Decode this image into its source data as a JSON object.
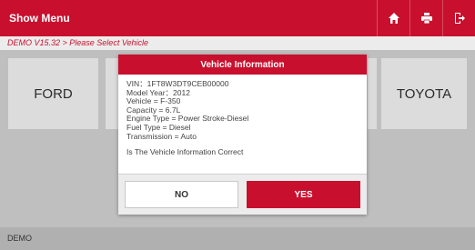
{
  "header": {
    "title": "Show Menu",
    "icons": [
      "home-icon",
      "print-icon",
      "exit-icon"
    ]
  },
  "breadcrumb": "DEMO V15.32 > Please Select  Vehicle",
  "brands": {
    "left": "FORD",
    "right": "TOYOTA"
  },
  "dialog": {
    "title": "Vehicle Information",
    "lines": [
      "VIN：1FT8W3DT9CEB00000",
      "Model Year：2012",
      "Vehicle = F-350",
      "Capacity = 6.7L",
      "Engine Type = Power Stroke-Diesel",
      "Fuel Type = Diesel",
      "Transmission = Auto"
    ],
    "question": "Is The Vehicle Information Correct",
    "no_label": "NO",
    "yes_label": "YES"
  },
  "status": "DEMO",
  "colors": {
    "accent": "#c8102e"
  }
}
